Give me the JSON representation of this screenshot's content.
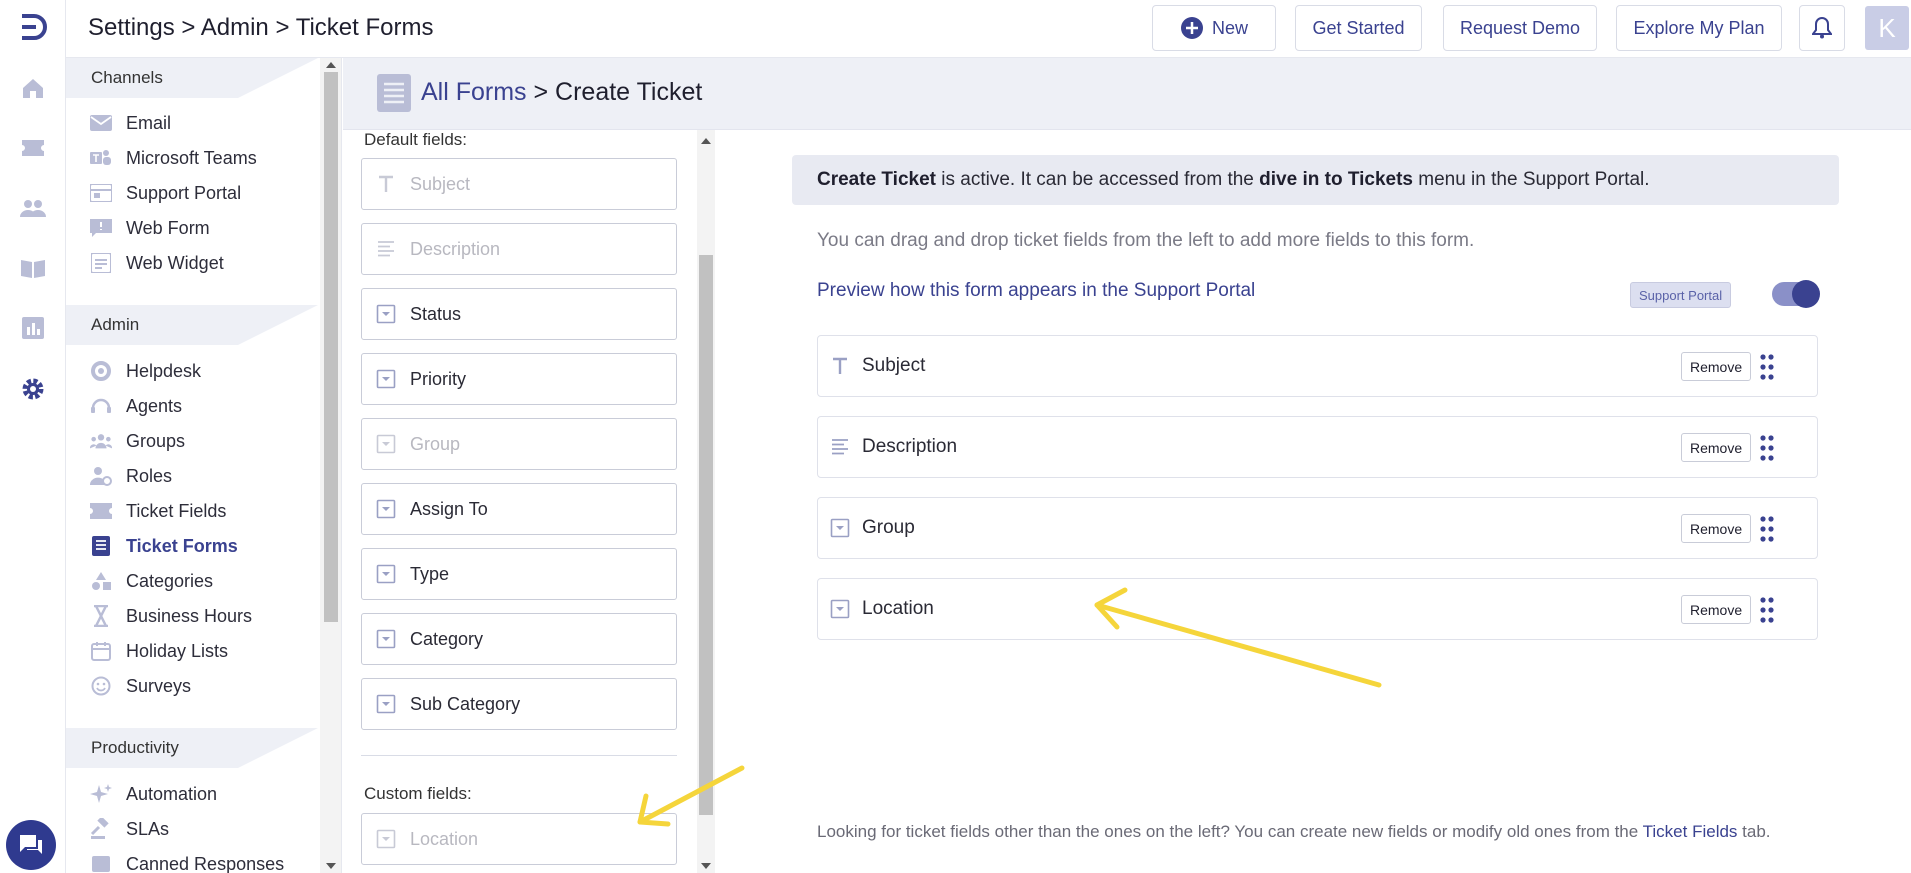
{
  "topbar": {
    "breadcrumb": "Settings > Admin > Ticket Forms",
    "new_label": "New",
    "get_started_label": "Get Started",
    "request_demo_label": "Request Demo",
    "explore_plan_label": "Explore My Plan",
    "avatar_letter": "K"
  },
  "rail": {
    "icons": [
      "home-icon",
      "tickets-icon",
      "contacts-icon",
      "knowledge-base-icon",
      "reports-icon",
      "settings-icon"
    ],
    "active": "settings-icon"
  },
  "sidebar": {
    "channels_heading": "Channels",
    "channels": [
      {
        "label": "Email",
        "icon": "mail-icon"
      },
      {
        "label": "Microsoft Teams",
        "icon": "teams-icon"
      },
      {
        "label": "Support Portal",
        "icon": "portal-icon"
      },
      {
        "label": "Web Form",
        "icon": "web-form-icon"
      },
      {
        "label": "Web Widget",
        "icon": "widget-icon"
      }
    ],
    "admin_heading": "Admin",
    "admin": [
      {
        "label": "Helpdesk",
        "icon": "helpdesk-icon"
      },
      {
        "label": "Agents",
        "icon": "agents-icon"
      },
      {
        "label": "Groups",
        "icon": "groups-icon"
      },
      {
        "label": "Roles",
        "icon": "roles-icon"
      },
      {
        "label": "Ticket Fields",
        "icon": "ticket-fields-icon"
      },
      {
        "label": "Ticket Forms",
        "icon": "ticket-forms-icon"
      },
      {
        "label": "Categories",
        "icon": "categories-icon"
      },
      {
        "label": "Business Hours",
        "icon": "hourglass-icon"
      },
      {
        "label": "Holiday Lists",
        "icon": "calendar-icon"
      },
      {
        "label": "Surveys",
        "icon": "smiley-icon"
      }
    ],
    "active_item": "Ticket Forms",
    "productivity_heading": "Productivity",
    "productivity": [
      {
        "label": "Automation",
        "icon": "sparkle-icon"
      },
      {
        "label": "SLAs",
        "icon": "gavel-icon"
      },
      {
        "label": "Canned Responses",
        "icon": "canned-icon"
      }
    ]
  },
  "page": {
    "all_forms_link": "All Forms",
    "title_rest": " > Create Ticket"
  },
  "palette": {
    "default_label": "Default fields:",
    "default_fields": [
      {
        "label": "Subject",
        "type": "text",
        "disabled": true
      },
      {
        "label": "Description",
        "type": "paragraph",
        "disabled": true
      },
      {
        "label": "Status",
        "type": "dropdown",
        "disabled": false
      },
      {
        "label": "Priority",
        "type": "dropdown",
        "disabled": false
      },
      {
        "label": "Group",
        "type": "dropdown",
        "disabled": true
      },
      {
        "label": "Assign To",
        "type": "dropdown",
        "disabled": false
      },
      {
        "label": "Type",
        "type": "dropdown",
        "disabled": false
      },
      {
        "label": "Category",
        "type": "dropdown",
        "disabled": false
      },
      {
        "label": "Sub Category",
        "type": "dropdown",
        "disabled": false
      }
    ],
    "custom_label": "Custom fields:",
    "custom_fields": [
      {
        "label": "Location",
        "type": "dropdown",
        "disabled": true
      }
    ]
  },
  "main": {
    "banner_name": "Create Ticket",
    "banner_mid": " is active. It can be accessed from the ",
    "banner_menu": "dive in to Tickets",
    "banner_end": " menu in the Support Portal.",
    "hint": "You can drag and drop ticket fields from the left to add more fields to this form.",
    "preview_link": "Preview how this form appears in the Support Portal",
    "portal_badge": "Support Portal",
    "toggle_on": true,
    "form_fields": [
      {
        "label": "Subject",
        "type": "text"
      },
      {
        "label": "Description",
        "type": "paragraph"
      },
      {
        "label": "Group",
        "type": "dropdown"
      },
      {
        "label": "Location",
        "type": "dropdown"
      }
    ],
    "remove_label": "Remove",
    "footer_pre": "Looking for ticket fields other than the ones on the left? You can create new fields or modify old ones from the ",
    "footer_link": "Ticket Fields",
    "footer_post": " tab."
  },
  "colors": {
    "accent": "#3a4290",
    "annotation": "#f5d53b",
    "header_band": "#eef0f6"
  }
}
